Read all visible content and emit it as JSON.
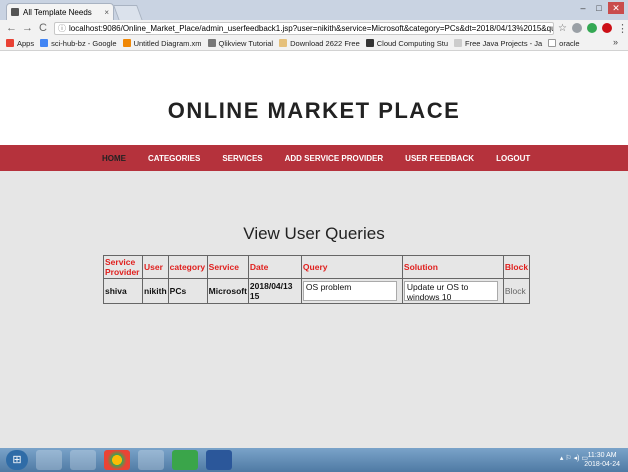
{
  "browser": {
    "tab_title": "All Template Needs",
    "tab_close": "×",
    "address": "localhost:9086/Online_Market_Place/admin_userfeedback1.jsp?user=nikith&service=Microsoft&category=PCs&dt=2018/04/13%2015&que...",
    "window_buttons": [
      "–",
      "□",
      "✕"
    ],
    "nav_icons": [
      "←",
      "→",
      "C"
    ],
    "bookmarks": [
      "Apps",
      "sci-hub-bz - Google",
      "Untitled Diagram.xm",
      "Qlikview Tutorial",
      "Download 2622 Free",
      "Cloud Computing Stu",
      "Free Java Projects - Ja",
      "oracle"
    ],
    "bookmarks_more": "»"
  },
  "site": {
    "title": "ONLINE MARKET PLACE",
    "nav": [
      "HOME",
      "CATEGORIES",
      "SERVICES",
      "ADD SERVICE PROVIDER",
      "USER FEEDBACK",
      "LOGOUT"
    ],
    "active_nav": "HOME",
    "accent_color": "#b5323c"
  },
  "main": {
    "section_title": "View User Queries",
    "table": {
      "headers": [
        "Service Provider",
        "User",
        "category",
        "Service",
        "Date",
        "Query",
        "Solution",
        "Block"
      ],
      "rows": [
        {
          "provider": "shiva",
          "user": "nikith",
          "category": "PCs",
          "service": "Microsoft",
          "date": "2018/04/13 15",
          "query": "OS problem",
          "solution": "Update ur OS to windows 10",
          "block": "Block"
        }
      ]
    }
  },
  "taskbar": {
    "time": "11:30 AM",
    "date": "2018-04-24"
  }
}
